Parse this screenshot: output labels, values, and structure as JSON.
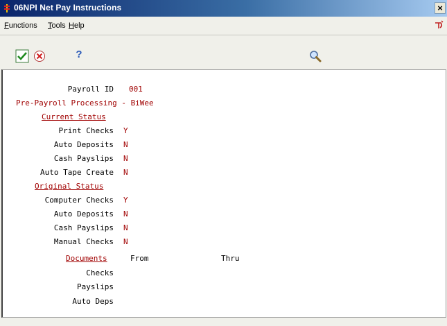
{
  "window": {
    "title": "06NPI  Net Pay Instructions",
    "close_label": "×"
  },
  "menu": {
    "functions": {
      "first": "F",
      "rest": "unctions"
    },
    "tools": {
      "first": "T",
      "rest": "ools"
    },
    "help": {
      "first": "H",
      "rest": "elp"
    }
  },
  "toolbar": {
    "help_label": "?"
  },
  "form": {
    "payroll_id_label": "Payroll ID",
    "payroll_id_value": "001",
    "description": "Pre-Payroll Processing - BiWee",
    "current_status": {
      "header": "Current Status",
      "rows": [
        {
          "label": "Print Checks",
          "value": "Y"
        },
        {
          "label": "Auto Deposits",
          "value": "N"
        },
        {
          "label": "Cash Payslips",
          "value": "N"
        },
        {
          "label": "Auto Tape Create",
          "value": "N"
        }
      ]
    },
    "original_status": {
      "header": "Original Status",
      "rows": [
        {
          "label": "Computer Checks",
          "value": "Y"
        },
        {
          "label": "Auto Deposits",
          "value": "N"
        },
        {
          "label": "Cash Payslips",
          "value": "N"
        },
        {
          "label": "Manual Checks",
          "value": "N"
        }
      ]
    },
    "documents": {
      "header": "Documents",
      "from_label": "From",
      "thru_label": "Thru",
      "rows": [
        {
          "label": "Checks"
        },
        {
          "label": "Payslips"
        },
        {
          "label": "Auto Deps"
        }
      ]
    }
  },
  "colors": {
    "field_value": "#a00000",
    "title_bar": "#0a246a"
  }
}
